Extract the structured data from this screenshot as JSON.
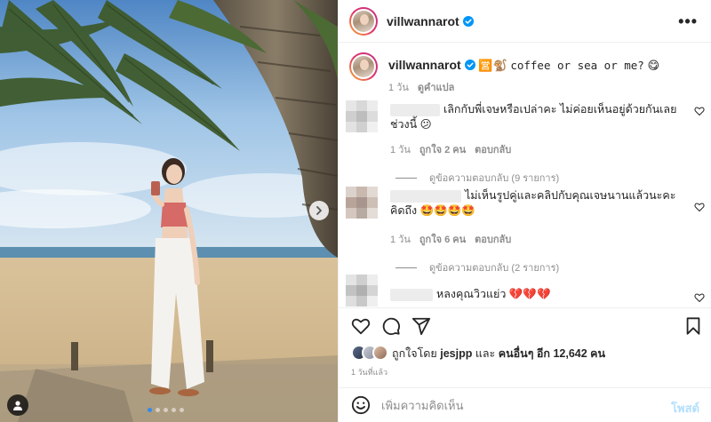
{
  "post": {
    "username": "villwannarot",
    "more_label": "•••",
    "photo": {
      "carousel_total": 5,
      "carousel_active": 1
    }
  },
  "caption": {
    "username": "villwannarot",
    "emoji_prefix": "🈺🐒",
    "text": "coffee or sea or me?",
    "emoji_suffix": "😋",
    "time": "1 วัน",
    "translate_label": "ดูคำแปล"
  },
  "comments": [
    {
      "text": "เลิกกับพี่เจษหรือเปล่าคะ ไม่ค่อยเห็นอยู่ด้วยกันเลยช่วงนี้ 😕",
      "time": "1 วัน",
      "likes": "ถูกใจ 2 คน",
      "reply_label": "ตอบกลับ",
      "view_replies": "ดูข้อความตอบกลับ (9 รายการ)"
    },
    {
      "text": "ไม่เห็นรูปคู่และคลิปกับคุณเจษนานแล้วนะคะคิดถึง 🤩🤩🤩🤩",
      "time": "1 วัน",
      "likes": "ถูกใจ 6 คน",
      "reply_label": "ตอบกลับ",
      "view_replies": "ดูข้อความตอบกลับ (2 รายการ)"
    },
    {
      "text": "หลงคุณวิวแย่ว 💔💔💔"
    }
  ],
  "likes": {
    "prefix": "ถูกใจโดย",
    "user": "jesjpp",
    "middle": "และ",
    "others": "คนอื่นๆ อีก 12,642 คน",
    "time_ago": "1 วันที่แล้ว"
  },
  "composer": {
    "placeholder": "เพิ่มความคิดเห็น",
    "post_label": "โพสต์"
  },
  "icons": {
    "verified": "verified-badge-icon",
    "heart": "heart-icon",
    "comment": "comment-icon",
    "share": "send-icon",
    "save": "bookmark-icon",
    "emoji": "emoji-icon",
    "next": "chevron-right-icon",
    "tags": "user-tag-icon",
    "more": "more-options-icon"
  },
  "colors": {
    "verified_blue": "#0095f6",
    "link_disabled": "#b2dffc",
    "muted_text": "#8e8e8e",
    "active_dot": "#2f8cf0"
  }
}
